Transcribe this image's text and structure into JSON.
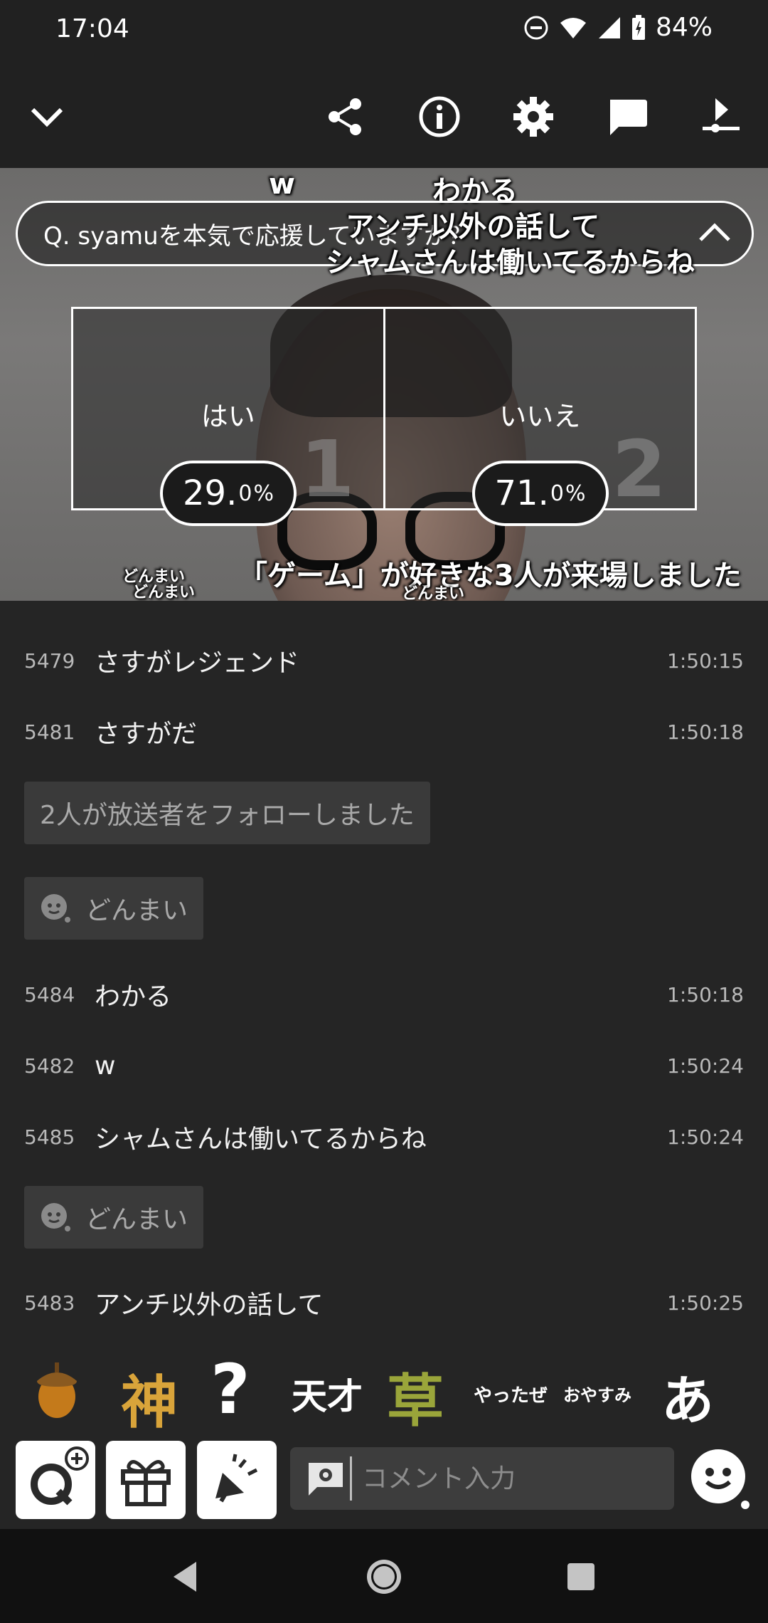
{
  "status_bar": {
    "time": "17:04",
    "battery": "84%"
  },
  "toolbar": {
    "icons": [
      "chevron-down-icon",
      "share-icon",
      "info-icon",
      "settings-icon",
      "comment-icon",
      "download-icon"
    ]
  },
  "video": {
    "danmaku": [
      {
        "text": "w"
      },
      {
        "text": "わかる"
      },
      {
        "text": "アンチ以外の話して"
      },
      {
        "text": "シャムさんは働いてるからね"
      },
      {
        "text": "「ゲーム」が好きな3人が来場しました"
      },
      {
        "text": "どんまい"
      },
      {
        "text": "どんまい"
      },
      {
        "text": "どんまい"
      }
    ],
    "question": "Q. syamuを本気で応援していますか？",
    "poll": {
      "options": [
        {
          "label": "はい",
          "number": "1",
          "percent_main": "29.",
          "percent_decimal": "0",
          "percent_sign": "%"
        },
        {
          "label": "いいえ",
          "number": "2",
          "percent_main": "71.",
          "percent_decimal": "0",
          "percent_sign": "%"
        }
      ]
    }
  },
  "comments": [
    {
      "no": "5479",
      "text": "さすがレジェンド",
      "time": "1:50:15"
    },
    {
      "no": "5481",
      "text": "さすがだ",
      "time": "1:50:18"
    },
    {
      "system": "2人が放送者をフォローしました"
    },
    {
      "system_emote": "どんまい"
    },
    {
      "no": "5484",
      "text": "わかる",
      "time": "1:50:18"
    },
    {
      "no": "5482",
      "text": "w",
      "time": "1:50:24"
    },
    {
      "no": "5485",
      "text": "シャムさんは働いてるからね",
      "time": "1:50:24"
    },
    {
      "system_emote": "どんまい"
    },
    {
      "no": "5483",
      "text": "アンチ以外の話して",
      "time": "1:50:25"
    }
  ],
  "stickers": [
    "神",
    "?",
    "天才",
    "草",
    "やったぜ",
    "おやすみ",
    "あ"
  ],
  "input": {
    "placeholder": "コメント入力"
  },
  "colors": {
    "background": "#252525",
    "bar": "#212121",
    "nav": "#111111",
    "acorn": "#c47a1b",
    "kusa": "#9aa53a"
  }
}
